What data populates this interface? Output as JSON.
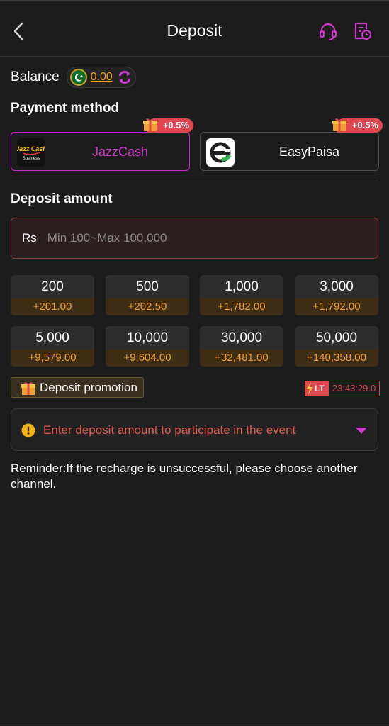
{
  "header": {
    "title": "Deposit",
    "back_icon": "chevron-left-icon",
    "support_icon": "headset-icon",
    "history_icon": "history-icon"
  },
  "balance": {
    "label": "Balance",
    "value": "0.00",
    "flag_icon": "pakistan-flag-icon",
    "refresh_icon": "refresh-icon"
  },
  "payment": {
    "title": "Payment method",
    "methods": [
      {
        "name": "JazzCash",
        "logo_text": "Jazz Cash",
        "logo_sub": "Business",
        "bonus": "+0.5%",
        "selected": true
      },
      {
        "name": "EasyPaisa",
        "bonus": "+0.5%",
        "selected": false
      }
    ]
  },
  "deposit": {
    "title": "Deposit amount",
    "currency": "Rs",
    "placeholder": "Min 100~Max 100,000",
    "amounts": [
      {
        "value": "200",
        "bonus": "+201.00"
      },
      {
        "value": "500",
        "bonus": "+202.50"
      },
      {
        "value": "1,000",
        "bonus": "+1,782.00"
      },
      {
        "value": "3,000",
        "bonus": "+1,792.00"
      },
      {
        "value": "5,000",
        "bonus": "+9,579.00"
      },
      {
        "value": "10,000",
        "bonus": "+9,604.00"
      },
      {
        "value": "30,000",
        "bonus": "+32,481.00"
      },
      {
        "value": "50,000",
        "bonus": "+140,358.00"
      }
    ]
  },
  "promotion": {
    "label": "Deposit promotion",
    "timer_badge": "LT",
    "timer": "23:43:29.0",
    "event_text": "Enter deposit amount to participate in the event"
  },
  "reminder": "Reminder:If the recharge is unsuccessful, please choose another channel.",
  "colors": {
    "background": "#1c1c1c",
    "accent_purple": "#c02ccc",
    "bonus_orange": "#f0a030",
    "alert_red": "#e0464e"
  }
}
